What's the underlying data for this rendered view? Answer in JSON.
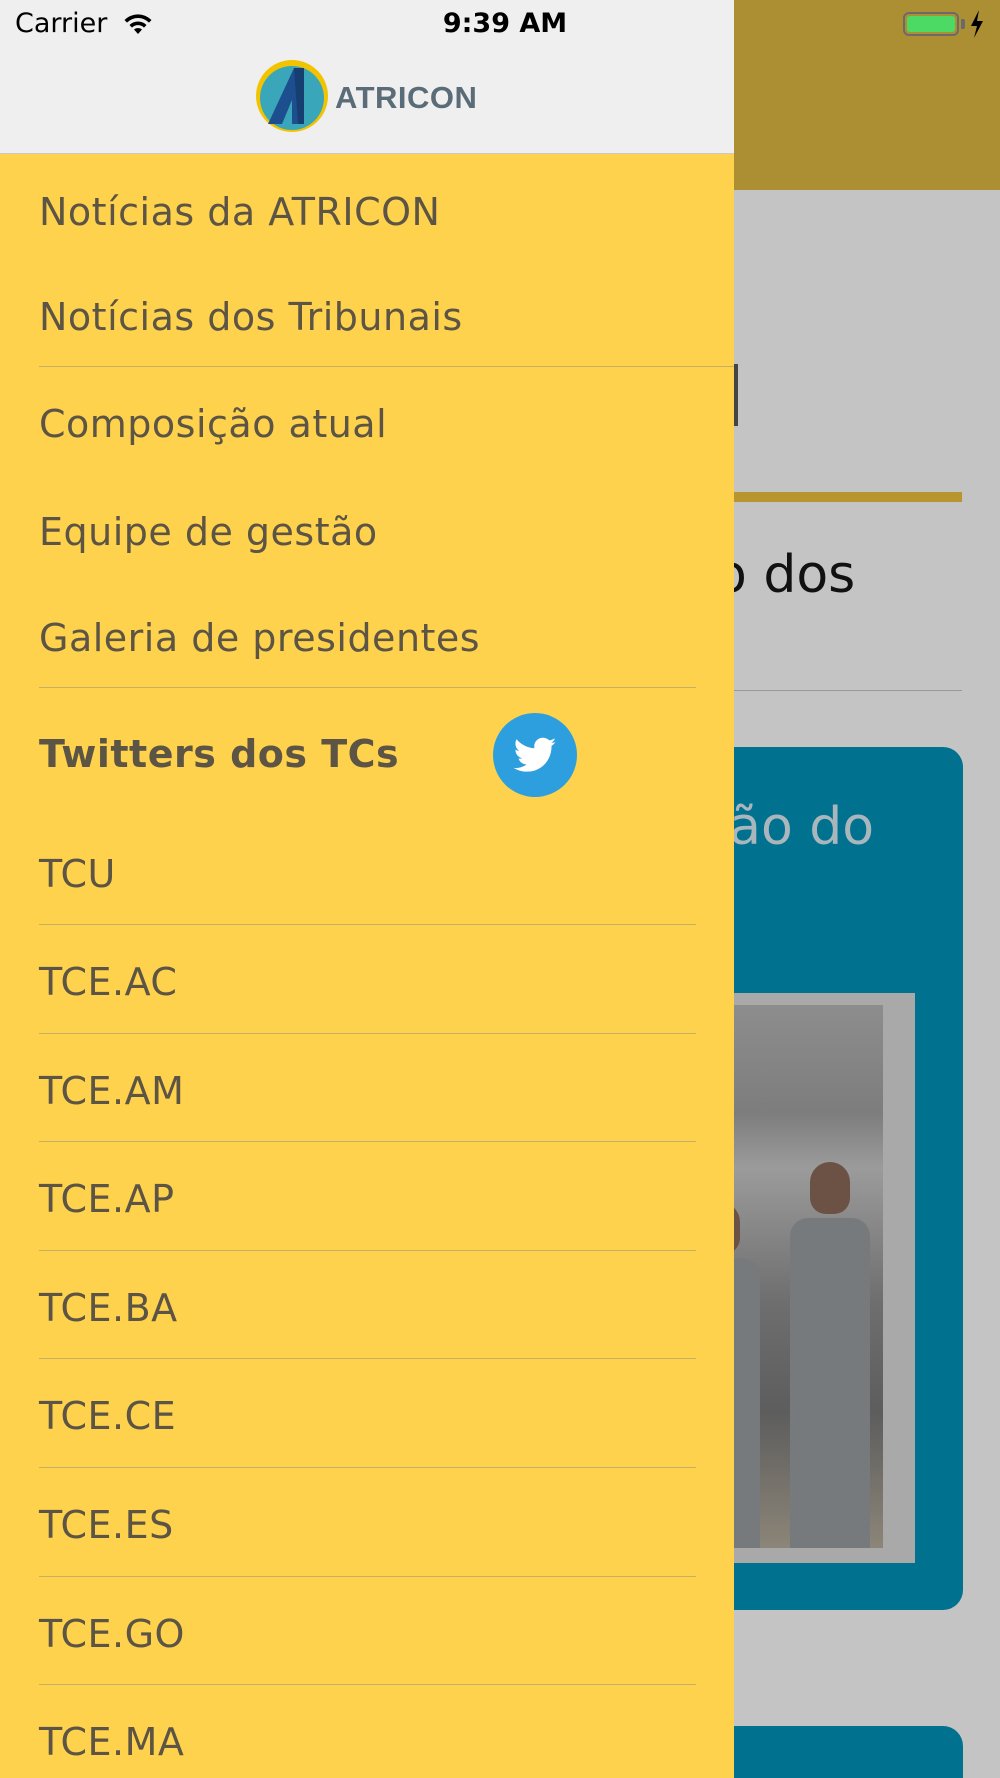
{
  "status_bar": {
    "carrier": "Carrier",
    "time": "9:39 AM",
    "wifi_icon": "wifi-icon",
    "battery_icon": "battery-icon",
    "charging_icon": "charging-bolt-icon",
    "battery_level": 1.0
  },
  "drawer": {
    "logo_text": "ATRICON",
    "menu": [
      {
        "label": "Notícias da ATRICON"
      },
      {
        "label": "Notícias dos Tribunais"
      },
      {
        "label": "Composição atual"
      },
      {
        "label": "Equipe de gestão"
      },
      {
        "label": "Galeria de presidentes"
      }
    ],
    "twitter_section": {
      "title": "Twitters dos TCs",
      "icon": "twitter-bird-icon"
    },
    "twitter_items": [
      {
        "label": "TCU"
      },
      {
        "label": "TCE.AC"
      },
      {
        "label": "TCE.AM"
      },
      {
        "label": "TCE.AP"
      },
      {
        "label": "TCE.BA"
      },
      {
        "label": "TCE.CE"
      },
      {
        "label": "TCE.ES"
      },
      {
        "label": "TCE.GO"
      },
      {
        "label": "TCE.MA"
      }
    ]
  },
  "background_page": {
    "heading_fragment": "o dos",
    "card_title_fragment": "são do"
  },
  "colors": {
    "drawer_background": "#ffd24d",
    "drawer_header": "#efefef",
    "menu_text": "#5c5444",
    "twitter_blue": "#2e9fde",
    "background_header": "#ad8f33",
    "card_teal": "#00718f"
  }
}
